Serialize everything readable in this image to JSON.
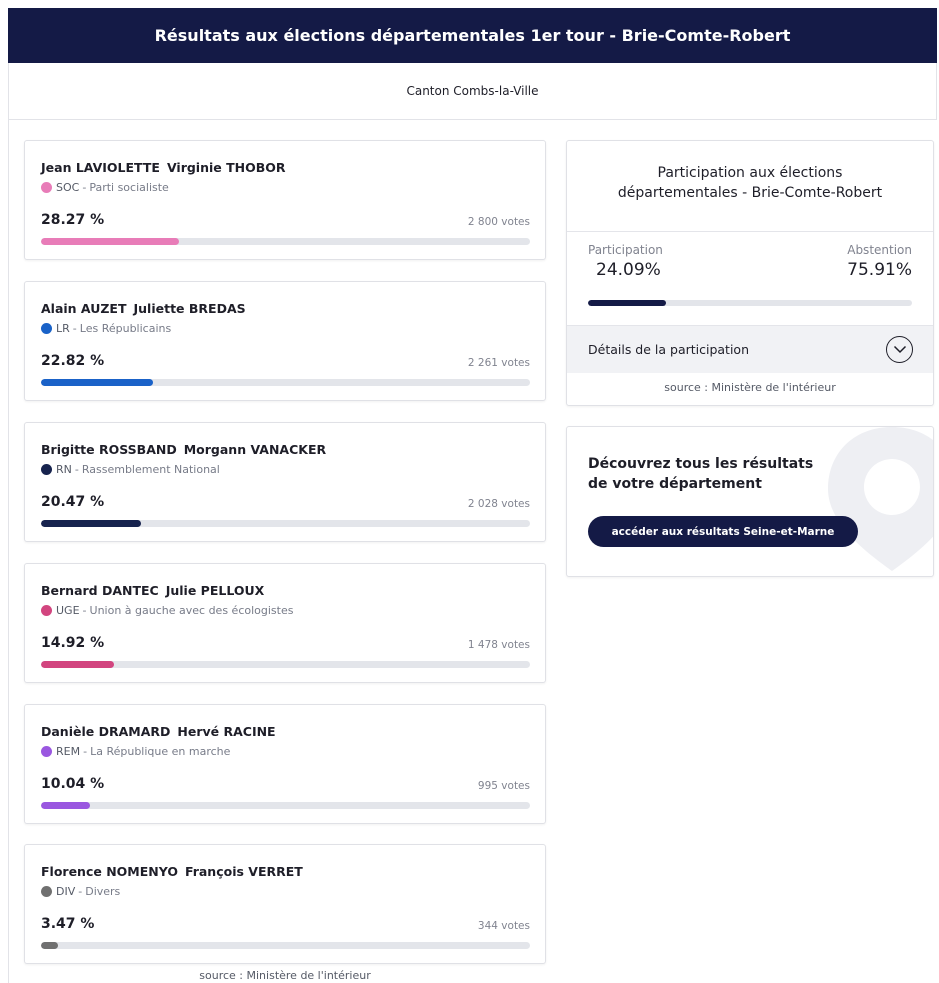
{
  "header": {
    "title": "Résultats aux élections départementales 1er tour - Brie-Comte-Robert"
  },
  "subheader": {
    "canton": "Canton Combs-la-Ville"
  },
  "candidates": [
    {
      "name1": "Jean LAVIOLETTE",
      "name2": "Virginie THOBOR",
      "party_abbr": "SOC",
      "party_name": "Parti socialiste",
      "color": "#e87cb8",
      "percent_label": "28.27 %",
      "percent": 28.27,
      "votes": "2 800 votes"
    },
    {
      "name1": "Alain AUZET",
      "name2": "Juliette BREDAS",
      "party_abbr": "LR",
      "party_name": "Les Républicains",
      "color": "#1a62c8",
      "percent_label": "22.82 %",
      "percent": 22.82,
      "votes": "2 261 votes"
    },
    {
      "name1": "Brigitte ROSSBAND",
      "name2": "Morgann VANACKER",
      "party_abbr": "RN",
      "party_name": "Rassemblement National",
      "color": "#17234e",
      "percent_label": "20.47 %",
      "percent": 20.47,
      "votes": "2 028 votes"
    },
    {
      "name1": "Bernard DANTEC",
      "name2": "Julie PELLOUX",
      "party_abbr": "UGE",
      "party_name": "Union à gauche avec des écologistes",
      "color": "#d2457f",
      "percent_label": "14.92 %",
      "percent": 14.92,
      "votes": "1 478 votes"
    },
    {
      "name1": "Danièle DRAMARD",
      "name2": "Hervé RACINE",
      "party_abbr": "REM",
      "party_name": "La République en marche",
      "color": "#9a57e0",
      "percent_label": "10.04 %",
      "percent": 10.04,
      "votes": "995 votes"
    },
    {
      "name1": "Florence NOMENYO",
      "name2": "François VERRET",
      "party_abbr": "DIV",
      "party_name": "Divers",
      "color": "#707070",
      "percent_label": "3.47 %",
      "percent": 3.47,
      "votes": "344 votes"
    }
  ],
  "left_source": "source : Ministère de l'intérieur",
  "participation": {
    "title_line1": "Participation aux élections",
    "title_line2": "départementales - Brie-Comte-Robert",
    "participation_label": "Participation",
    "participation_value": "24.09%",
    "participation_percent": 24.09,
    "abstention_label": "Abstention",
    "abstention_value": "75.91%",
    "details_label": "Détails de la participation",
    "details_icon": "chevron-down-circle-icon",
    "source": "source : Ministère de l'intérieur"
  },
  "discover": {
    "line1": "Découvrez tous les résultats",
    "line2": "de votre département",
    "button_label": "accéder aux résultats Seine-et-Marne",
    "decor_icon": "map-pin-icon"
  },
  "colors": {
    "navy": "#141a46",
    "track": "#e3e5ea"
  }
}
